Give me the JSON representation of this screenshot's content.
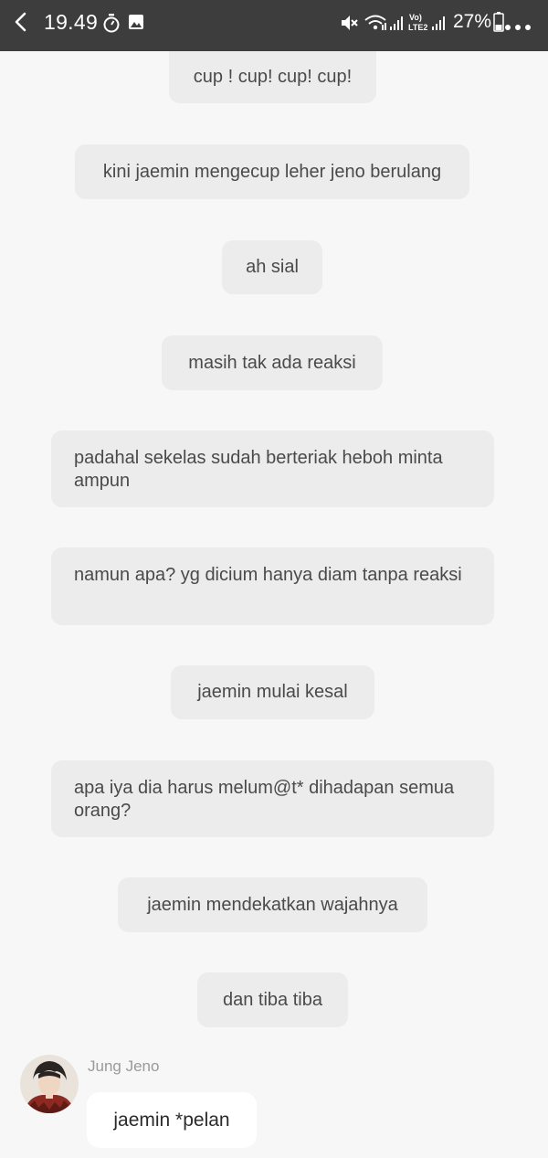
{
  "status_bar": {
    "time": "19.49",
    "battery": "27%",
    "icons": [
      "back-arrow-icon",
      "timer-icon",
      "image-icon",
      "mute-icon",
      "wifi-icon",
      "signal-icon",
      "volte-lte2-icon",
      "battery-icon",
      "more-dots-icon"
    ]
  },
  "narration": [
    "cup ! cup! cup! cup!",
    "kini jaemin mengecup leher jeno berulang",
    "ah sial",
    "masih tak ada reaksi",
    "padahal sekelas sudah berteriak heboh minta ampun",
    "namun apa? yg dicium hanya diam tanpa reaksi",
    "jaemin mulai kesal",
    "apa iya dia harus melum@t* dihadapan semua orang?",
    "jaemin mendekatkan wajahnya",
    "dan tiba tiba"
  ],
  "message": {
    "sender": "Jung Jeno",
    "text": "jaemin *pelan"
  },
  "colors": {
    "status_bar_bg": "#3d3d3d",
    "chat_bg": "#f7f7f7",
    "narration_bubble": "#ececec",
    "incoming_bubble": "#ffffff"
  }
}
